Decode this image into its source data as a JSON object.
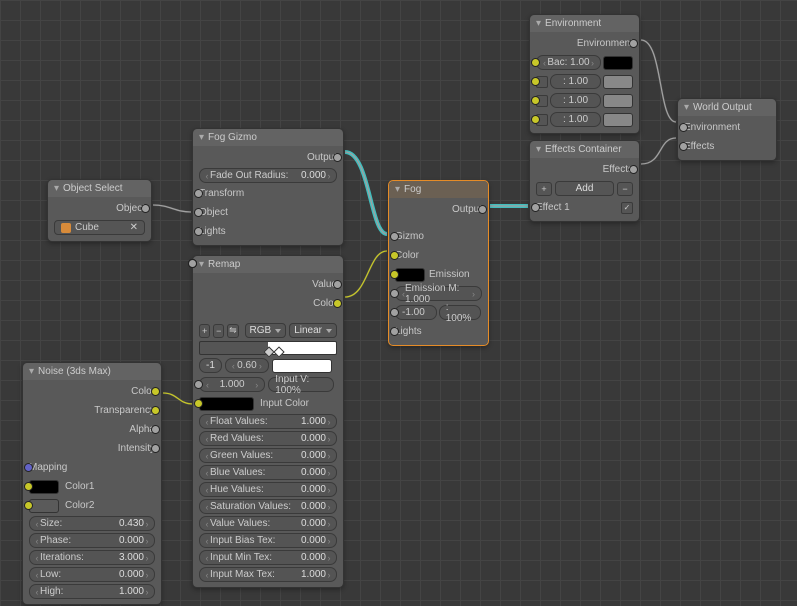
{
  "objectSelect": {
    "title": "Object Select",
    "out": "Object",
    "item": "Cube"
  },
  "noise": {
    "title": "Noise (3ds Max)",
    "outs": [
      "Color",
      "Transparency",
      "Alpha",
      "Intensity"
    ],
    "ins": {
      "mapping": "Mapping",
      "color1": "Color1",
      "color2": "Color2"
    },
    "params": [
      {
        "n": "Size:",
        "v": "0.430"
      },
      {
        "n": "Phase:",
        "v": "0.000"
      },
      {
        "n": "Iterations:",
        "v": "3.000"
      },
      {
        "n": "Low:",
        "v": "0.000"
      },
      {
        "n": "High:",
        "v": "1.000"
      }
    ]
  },
  "fogGizmo": {
    "title": "Fog Gizmo",
    "out": "Output",
    "fade": "Fade Out Radius:",
    "fadev": "0.000",
    "ins": [
      "Transform",
      "Object",
      "Lights"
    ]
  },
  "remap": {
    "title": "Remap",
    "outs": [
      "Value",
      "Color"
    ],
    "mode": "RGB",
    "interp": "Linear",
    "p1": "-1",
    "p2": "0.60",
    "inv": "1.000",
    "invlbl": "Input V: 100%",
    "inclbl": "Input Color",
    "params": [
      {
        "n": "Float Values:",
        "v": "1.000"
      },
      {
        "n": "Red Values:",
        "v": "0.000"
      },
      {
        "n": "Green Values:",
        "v": "0.000"
      },
      {
        "n": "Blue Values:",
        "v": "0.000"
      },
      {
        "n": "Hue Values:",
        "v": "0.000"
      },
      {
        "n": "Saturation Values:",
        "v": "0.000"
      },
      {
        "n": "Value Values:",
        "v": "0.000"
      },
      {
        "n": "Input Bias Tex:",
        "v": "0.000"
      },
      {
        "n": "Input Min Tex:",
        "v": "0.000"
      },
      {
        "n": "Input Max Tex:",
        "v": "1.000"
      }
    ]
  },
  "fog": {
    "title": "Fog",
    "out": "Output",
    "gizmo": "Gizmo",
    "color": "Color",
    "emission": "Emission",
    "emm": "Emission M: 1.000",
    "v1": "-1.00",
    "v2": ": 100%",
    "lights": "Lights"
  },
  "env": {
    "title": "Environment",
    "lbl": "Environment",
    "bac": "Bac: 1.00",
    "r1": ": 1.00",
    "r2": ": 1.00",
    "r3": ": 1.00"
  },
  "effects": {
    "title": "Effects Container",
    "out": "Effects",
    "add": "Add",
    "eff1": "Effect 1"
  },
  "world": {
    "title": "World Output",
    "env": "Environment",
    "eff": "Effects"
  }
}
